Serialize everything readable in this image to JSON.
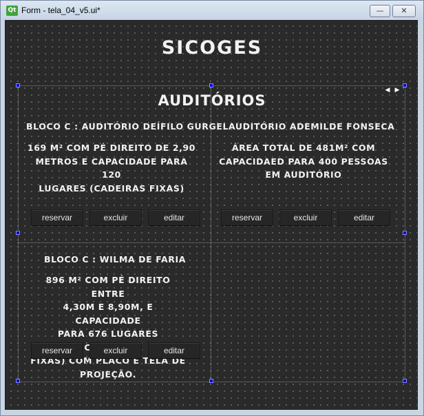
{
  "window": {
    "logo_text": "Qt",
    "title": "Form - tela_04_v5.ui*",
    "minimize_glyph": "—",
    "close_glyph": "✕"
  },
  "app": {
    "title": "SICOGES",
    "section_title": "AUDITÓRIOS",
    "nav_prev": "◀",
    "nav_next": "▶"
  },
  "cards": [
    {
      "title": "BLOCO C : AUDITÓRIO DEÍFILO GURGEL",
      "desc_lines": [
        "169 M² COM PÉ DIREITO DE 2,90",
        "METROS E CAPACIDADE PARA 120",
        "LUGARES (CADEIRAS FIXAS)"
      ],
      "buttons": [
        "reservar",
        "excluir",
        "editar"
      ]
    },
    {
      "title": "AUDITÓRIO ADEMILDE FONSECA",
      "desc_lines": [
        "ÁREA TOTAL DE 481M² COM",
        "CAPACIDAED PARA 400 PESSOAS",
        "EM AUDITÓRIO"
      ],
      "buttons": [
        "reservar",
        "excluir",
        "editar"
      ]
    },
    {
      "title": "BLOCO C : WILMA DE FARIA",
      "desc_lines": [
        "896 M² COM PÉ DIREITO ENTRE",
        "4,30M E 8,90M, E CAPACIDADE",
        "PARA 676 LUGARES (CADEIRAS",
        "FIXAS) COM PLACO E TELA DE",
        "PROJEÇÃO."
      ],
      "buttons": [
        "reservar",
        "excluir",
        "editar"
      ]
    }
  ]
}
